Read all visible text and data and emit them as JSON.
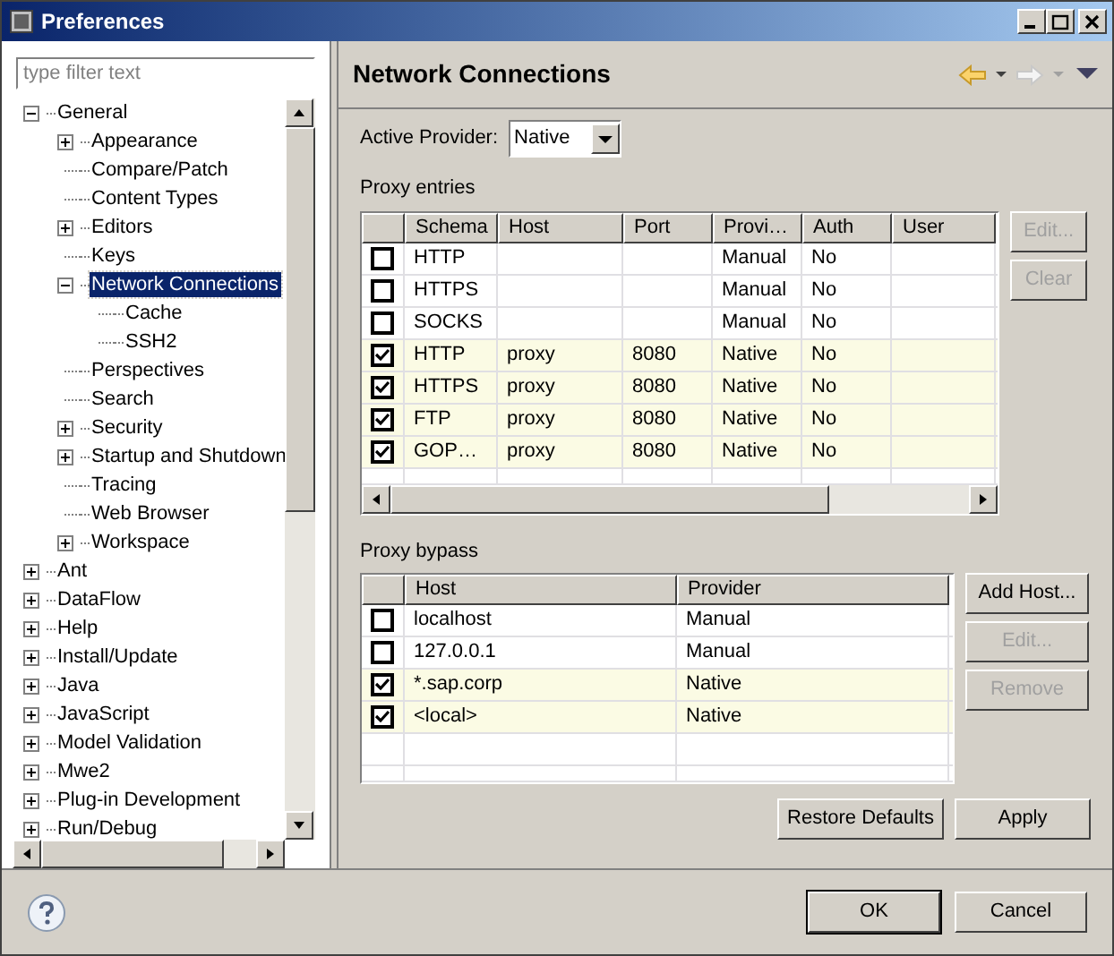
{
  "window": {
    "title": "Preferences"
  },
  "filter": {
    "placeholder": "type filter text"
  },
  "tree": {
    "items": [
      {
        "label": "General",
        "kind": "folder",
        "expanded": true,
        "selected": false,
        "children": [
          {
            "label": "Appearance",
            "kind": "folder",
            "expanded": false,
            "selected": false
          },
          {
            "label": "Compare/Patch",
            "kind": "leaf",
            "selected": false
          },
          {
            "label": "Content Types",
            "kind": "leaf",
            "selected": false
          },
          {
            "label": "Editors",
            "kind": "folder",
            "expanded": false,
            "selected": false
          },
          {
            "label": "Keys",
            "kind": "leaf",
            "selected": false
          },
          {
            "label": "Network Connections",
            "kind": "folder",
            "expanded": true,
            "selected": true,
            "children": [
              {
                "label": "Cache",
                "kind": "leaf",
                "selected": false
              },
              {
                "label": "SSH2",
                "kind": "leaf",
                "selected": false
              }
            ]
          },
          {
            "label": "Perspectives",
            "kind": "leaf",
            "selected": false
          },
          {
            "label": "Search",
            "kind": "leaf",
            "selected": false
          },
          {
            "label": "Security",
            "kind": "folder",
            "expanded": false,
            "selected": false
          },
          {
            "label": "Startup and Shutdown",
            "kind": "folder",
            "expanded": false,
            "selected": false
          },
          {
            "label": "Tracing",
            "kind": "leaf",
            "selected": false
          },
          {
            "label": "Web Browser",
            "kind": "leaf",
            "selected": false
          },
          {
            "label": "Workspace",
            "kind": "folder",
            "expanded": false,
            "selected": false
          }
        ]
      },
      {
        "label": "Ant",
        "kind": "folder",
        "expanded": false,
        "selected": false
      },
      {
        "label": "DataFlow",
        "kind": "folder",
        "expanded": false,
        "selected": false
      },
      {
        "label": "Help",
        "kind": "folder",
        "expanded": false,
        "selected": false
      },
      {
        "label": "Install/Update",
        "kind": "folder",
        "expanded": false,
        "selected": false
      },
      {
        "label": "Java",
        "kind": "folder",
        "expanded": false,
        "selected": false
      },
      {
        "label": "JavaScript",
        "kind": "folder",
        "expanded": false,
        "selected": false
      },
      {
        "label": "Model Validation",
        "kind": "folder",
        "expanded": false,
        "selected": false
      },
      {
        "label": "Mwe2",
        "kind": "folder",
        "expanded": false,
        "selected": false
      },
      {
        "label": "Plug-in Development",
        "kind": "folder",
        "expanded": false,
        "selected": false
      },
      {
        "label": "Run/Debug",
        "kind": "folder",
        "expanded": false,
        "selected": false
      }
    ]
  },
  "page": {
    "title": "Network Connections"
  },
  "active_provider": {
    "label": "Active Provider:",
    "value": "Native"
  },
  "proxy_entries": {
    "title": "Proxy entries",
    "columns": [
      "Schema",
      "Host",
      "Port",
      "Provi…",
      "Auth",
      "User"
    ],
    "rows": [
      {
        "checked": false,
        "cells": [
          "HTTP",
          "",
          "",
          "Manual",
          "No",
          ""
        ]
      },
      {
        "checked": false,
        "cells": [
          "HTTPS",
          "",
          "",
          "Manual",
          "No",
          ""
        ]
      },
      {
        "checked": false,
        "cells": [
          "SOCKS",
          "",
          "",
          "Manual",
          "No",
          ""
        ]
      },
      {
        "checked": true,
        "cells": [
          "HTTP",
          "proxy",
          "8080",
          "Native",
          "No",
          ""
        ]
      },
      {
        "checked": true,
        "cells": [
          "HTTPS",
          "proxy",
          "8080",
          "Native",
          "No",
          ""
        ]
      },
      {
        "checked": true,
        "cells": [
          "FTP",
          "proxy",
          "8080",
          "Native",
          "No",
          ""
        ]
      },
      {
        "checked": true,
        "cells": [
          "GOP…",
          "proxy",
          "8080",
          "Native",
          "No",
          ""
        ]
      }
    ],
    "buttons": [
      {
        "label": "Edit...",
        "disabled": true
      },
      {
        "label": "Clear",
        "disabled": true
      }
    ]
  },
  "proxy_bypass": {
    "title": "Proxy bypass",
    "columns": [
      "Host",
      "Provider"
    ],
    "rows": [
      {
        "checked": false,
        "cells": [
          "localhost",
          "Manual"
        ]
      },
      {
        "checked": false,
        "cells": [
          "127.0.0.1",
          "Manual"
        ]
      },
      {
        "checked": true,
        "cells": [
          "*.sap.corp",
          "Native"
        ]
      },
      {
        "checked": true,
        "cells": [
          "<local>",
          "Native"
        ]
      }
    ],
    "buttons": [
      {
        "label": "Add Host...",
        "disabled": false
      },
      {
        "label": "Edit...",
        "disabled": true
      },
      {
        "label": "Remove",
        "disabled": true
      }
    ]
  },
  "page_buttons": [
    {
      "label": "Restore Defaults",
      "disabled": false
    },
    {
      "label": "Apply",
      "disabled": false
    }
  ],
  "dialog_buttons": [
    {
      "label": "OK",
      "disabled": false
    },
    {
      "label": "Cancel",
      "disabled": false
    }
  ]
}
